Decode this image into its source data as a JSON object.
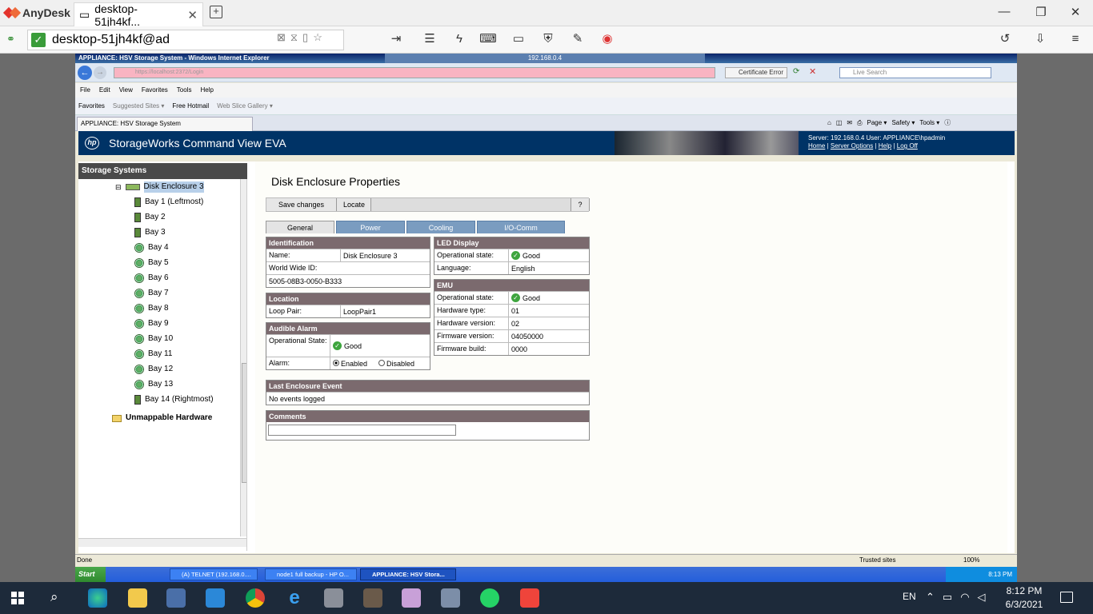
{
  "anydesk": {
    "app_name": "AnyDesk",
    "tab_title": "desktop-51jh4kf...",
    "address": "desktop-51jh4kf@ad",
    "monitor_number": "1"
  },
  "ie": {
    "window_title": "APPLIANCE: HSV Storage System - Windows Internet Explorer",
    "anydesk_caption": "192.168.0.4",
    "url": "https://localhost:2372/Login",
    "cert_error": "Certificate Error",
    "search_placeholder": "Live Search",
    "menu": [
      "File",
      "Edit",
      "View",
      "Favorites",
      "Tools",
      "Help"
    ],
    "favorites": [
      "Favorites",
      "Suggested Sites ▾",
      "Free Hotmail",
      "Web Slice Gallery ▾"
    ],
    "tab_title": "APPLIANCE: HSV Storage System",
    "tools": [
      "Page ▾",
      "Safety ▾",
      "Tools ▾"
    ],
    "status_text": "Done",
    "zone": "Trusted sites",
    "zoom": "100%"
  },
  "banner": {
    "title": "StorageWorks Command View EVA",
    "server_line": "Server:  192.168.0.4    User:  APPLIANCE\\hpadmin",
    "links": [
      "Home",
      "Server Options",
      "Help",
      "Log Off"
    ]
  },
  "tree": {
    "header": "Storage Systems",
    "enclosure": "Disk Enclosure 3",
    "bays": [
      "Bay 1 (Leftmost)",
      "Bay 2",
      "Bay 3",
      "Bay 4",
      "Bay 5",
      "Bay 6",
      "Bay 7",
      "Bay 8",
      "Bay 9",
      "Bay 10",
      "Bay 11",
      "Bay 12",
      "Bay 13",
      "Bay 14 (Rightmost)"
    ],
    "unmappable": "Unmappable Hardware"
  },
  "panel": {
    "title": "Disk Enclosure Properties",
    "buttons": {
      "save": "Save changes",
      "locate": "Locate",
      "help": "?"
    },
    "tabs": [
      "General",
      "Power",
      "Cooling",
      "I/O-Comm"
    ],
    "identification": {
      "header": "Identification",
      "name_label": "Name:",
      "name_value": "Disk Enclosure 3",
      "wwid_label": "World Wide ID:",
      "wwid_value": "5005-08B3-0050-B333"
    },
    "location": {
      "header": "Location",
      "loop_label": "Loop Pair:",
      "loop_value": "LoopPair1"
    },
    "alarm": {
      "header": "Audible Alarm",
      "state_label": "Operational State:",
      "state_value": "Good",
      "alarm_label": "Alarm:",
      "enabled": "Enabled",
      "disabled": "Disabled"
    },
    "led": {
      "header": "LED Display",
      "state_label": "Operational state:",
      "state_value": "Good",
      "lang_label": "Language:",
      "lang_value": "English"
    },
    "emu": {
      "header": "EMU",
      "state_label": "Operational state:",
      "state_value": "Good",
      "hwtype_label": "Hardware type:",
      "hwtype_value": "01",
      "hwver_label": "Hardware version:",
      "hwver_value": "02",
      "fwver_label": "Firmware version:",
      "fwver_value": "04050000",
      "fwbuild_label": "Firmware build:",
      "fwbuild_value": "0000"
    },
    "event": {
      "header": "Last Enclosure Event",
      "value": "No events logged"
    },
    "comments": {
      "header": "Comments"
    }
  },
  "xp_taskbar": {
    "start": "Start",
    "buttons": [
      "(A) TELNET (192.168.0....",
      "node1 full backup - HP O...",
      "APPLIANCE: HSV Stora..."
    ],
    "time": "8:13 PM"
  },
  "win10": {
    "lang": "EN",
    "time": "8:12 PM",
    "date": "6/3/2021"
  },
  "colors": {
    "banner": "#003366",
    "tab_inactive": "#7a9cc0",
    "section_header": "#7b6a6e",
    "good": "#3ea53e"
  }
}
